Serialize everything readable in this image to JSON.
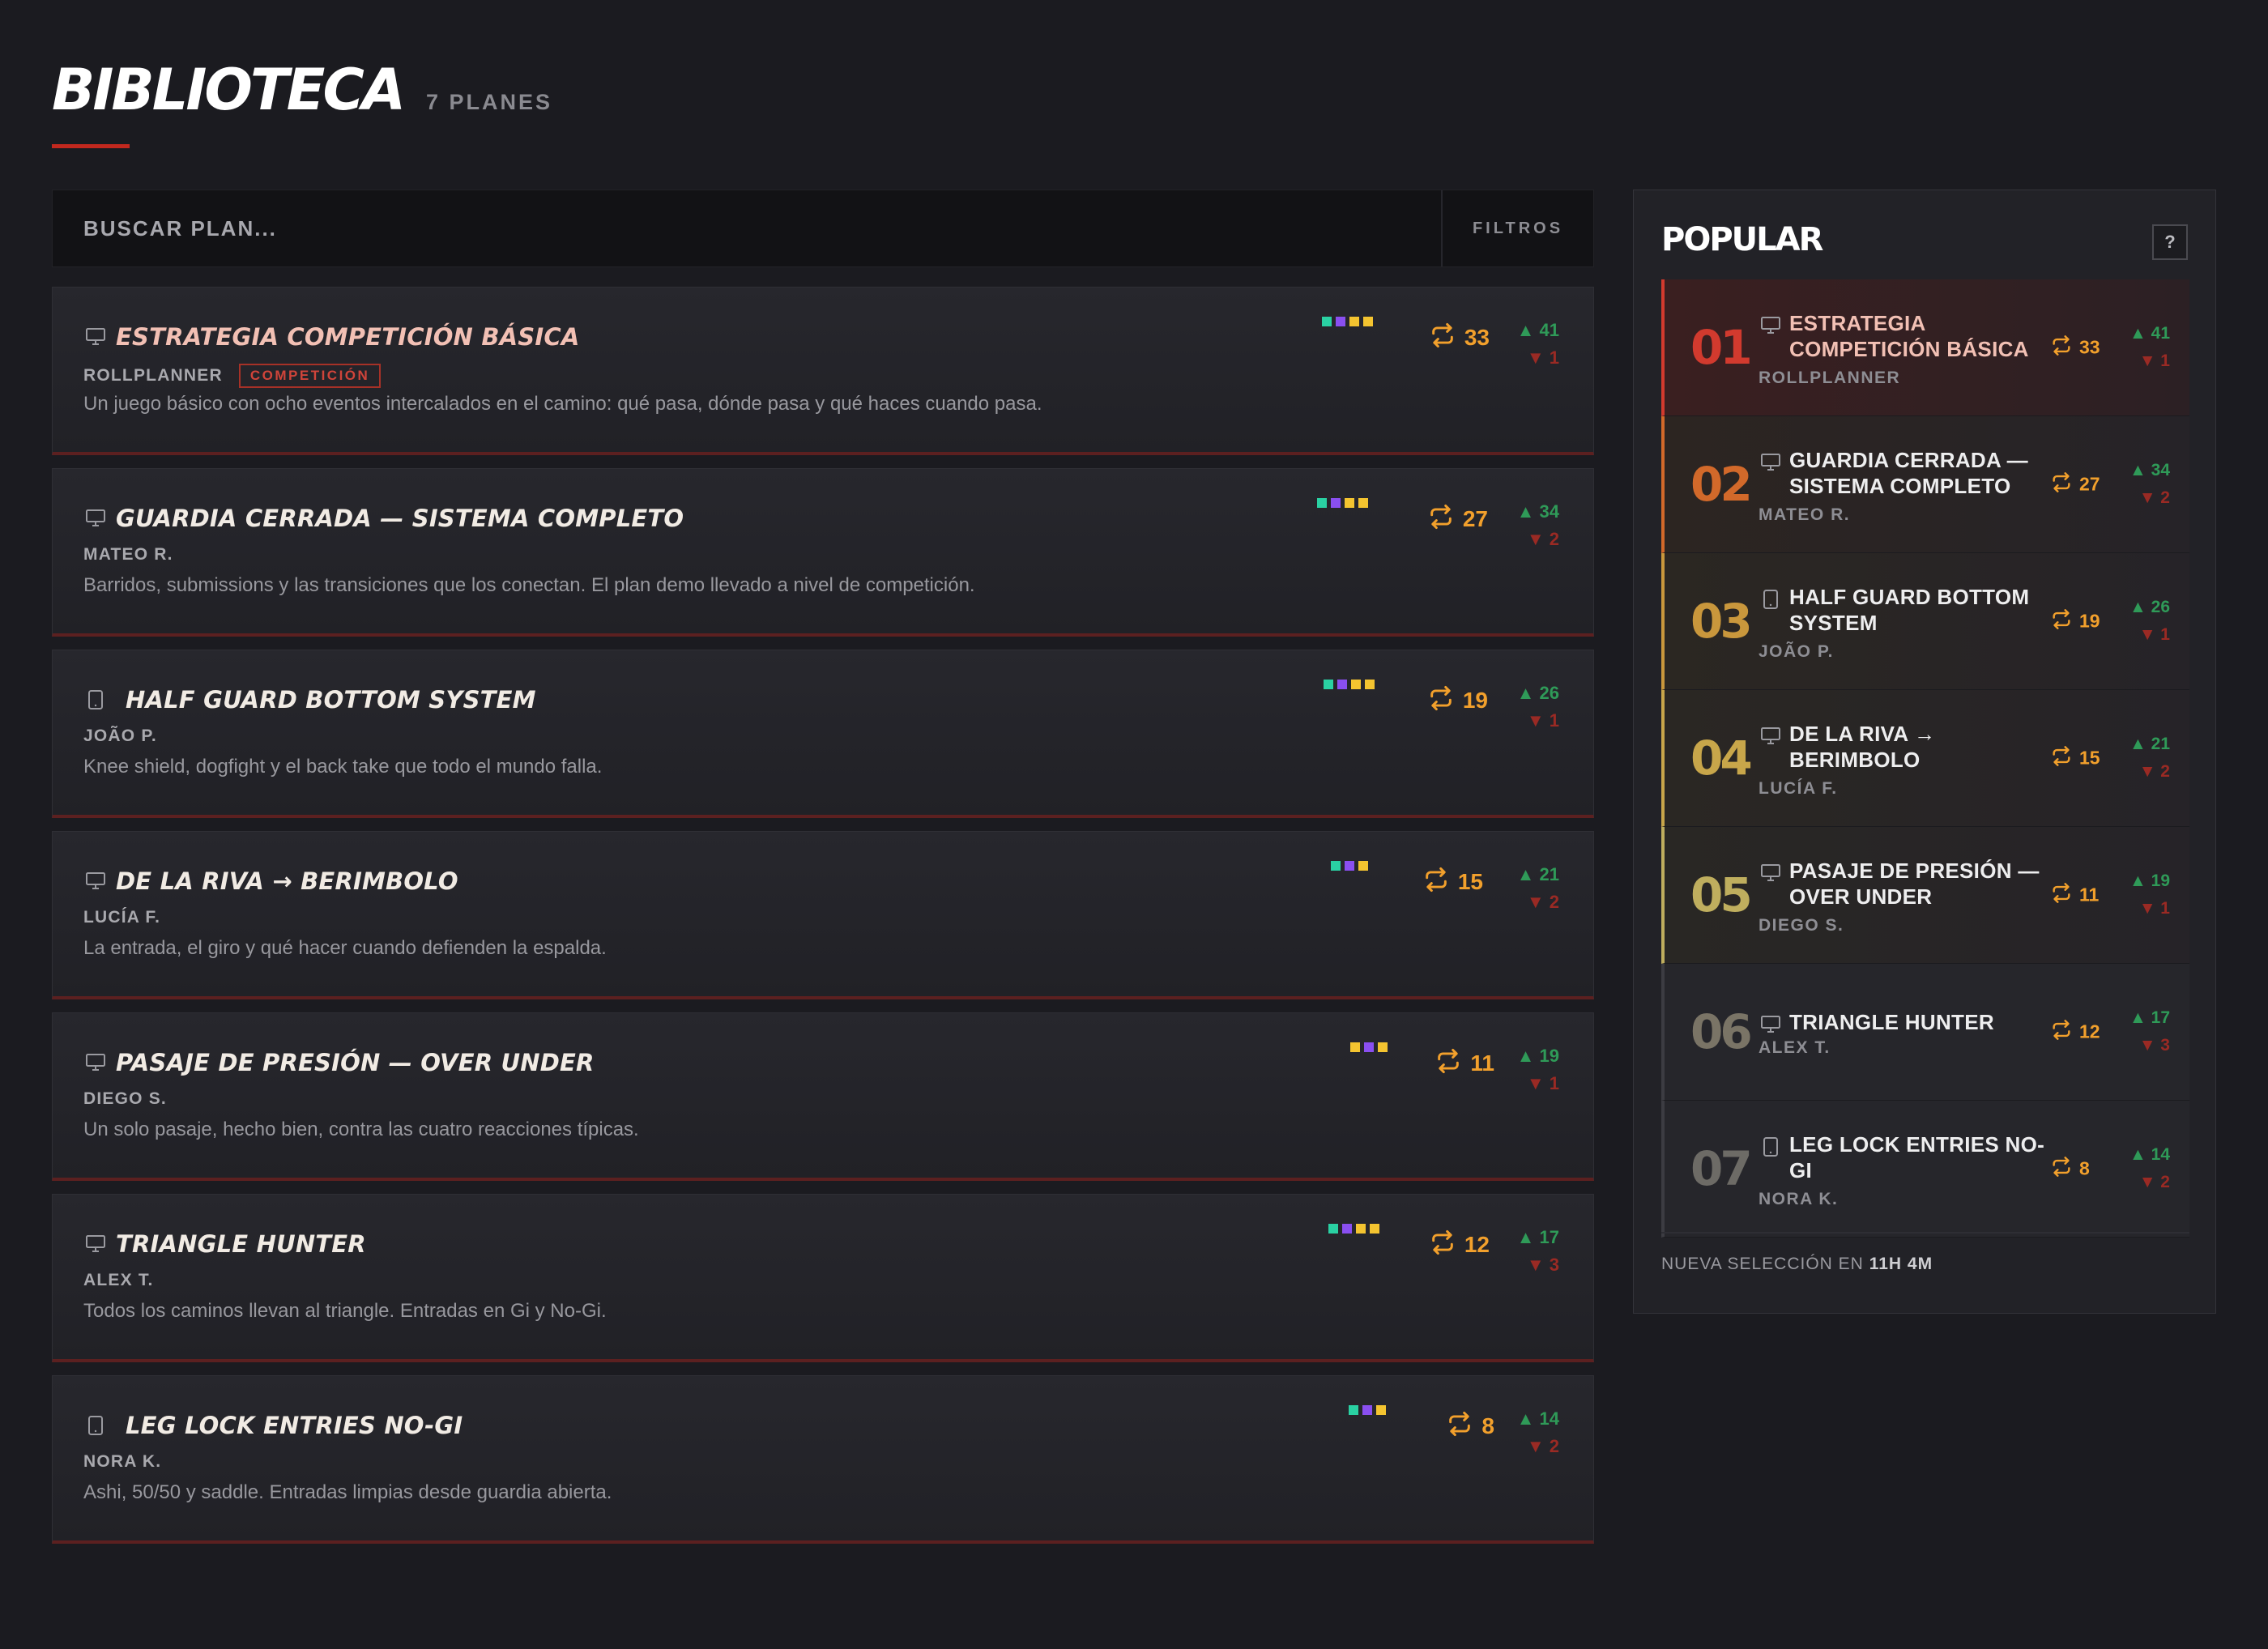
{
  "header": {
    "title": "BIBLIOTECA",
    "count": "7 PLANES"
  },
  "search": {
    "placeholder": "BUSCAR PLAN...",
    "filters_label": "FILTROS"
  },
  "colors": {
    "teal": "#2ad1a3",
    "purple": "#8a4ff0",
    "yellow": "#f4c430",
    "accent_red": "#c2281e",
    "remix_orange": "#f2a02c",
    "vote_up": "#2f9a58",
    "vote_down": "#9a2a24"
  },
  "plans": [
    {
      "title": "ESTRATEGIA COMPETICIÓN BÁSICA",
      "author": "ROLLPLANNER",
      "badge": "COMPETICIÓN",
      "description": "Un juego básico con ocho eventos intercalados en el camino: qué pasa, dónde pasa y qué haces cuando pasa.",
      "remixes": "33",
      "up": "▲ 41",
      "down": "▼ 1",
      "icon": "monitor-icon",
      "dots": [
        "teal",
        "purple",
        "yellow",
        "yellow"
      ]
    },
    {
      "title": "GUARDIA CERRADA — SISTEMA COMPLETO",
      "author": "MATEO R.",
      "badge": "",
      "description": "Barridos, submissions y las transiciones que los conectan. El plan demo llevado a nivel de competición.",
      "remixes": "27",
      "up": "▲ 34",
      "down": "▼ 2",
      "icon": "monitor-icon",
      "dots": [
        "teal",
        "purple",
        "yellow",
        "yellow"
      ]
    },
    {
      "title": "HALF GUARD BOTTOM SYSTEM",
      "author": "JOÃO P.",
      "badge": "",
      "description": "Knee shield, dogfight y el back take que todo el mundo falla.",
      "remixes": "19",
      "up": "▲ 26",
      "down": "▼ 1",
      "icon": "tablet-icon",
      "dots": [
        "teal",
        "purple",
        "yellow",
        "yellow"
      ]
    },
    {
      "title": "DE LA RIVA → BERIMBOLO",
      "author": "LUCÍA F.",
      "badge": "",
      "description": "La entrada, el giro y qué hacer cuando defienden la espalda.",
      "remixes": "15",
      "up": "▲ 21",
      "down": "▼ 2",
      "icon": "monitor-icon",
      "dots": [
        "teal",
        "purple",
        "yellow"
      ]
    },
    {
      "title": "PASAJE DE PRESIÓN — OVER UNDER",
      "author": "DIEGO S.",
      "badge": "",
      "description": "Un solo pasaje, hecho bien, contra las cuatro reacciones típicas.",
      "remixes": "11",
      "up": "▲ 19",
      "down": "▼ 1",
      "icon": "monitor-icon",
      "dots": [
        "yellow",
        "purple",
        "yellow"
      ]
    },
    {
      "title": "TRIANGLE HUNTER",
      "author": "ALEX T.",
      "badge": "",
      "description": "Todos los caminos llevan al triangle. Entradas en Gi y No-Gi.",
      "remixes": "12",
      "up": "▲ 17",
      "down": "▼ 3",
      "icon": "monitor-icon",
      "dots": [
        "teal",
        "purple",
        "yellow",
        "yellow"
      ]
    },
    {
      "title": "LEG LOCK ENTRIES NO-GI",
      "author": "NORA K.",
      "badge": "",
      "description": "Ashi, 50/50 y saddle. Entradas limpias desde guardia abierta.",
      "remixes": "8",
      "up": "▲ 14",
      "down": "▼ 2",
      "icon": "tablet-icon",
      "dots": [
        "teal",
        "purple",
        "yellow"
      ]
    }
  ],
  "popular": {
    "title": "POPULAR",
    "help_label": "?",
    "items": [
      {
        "rank": "01",
        "title": "ESTRATEGIA COMPETICIÓN BÁSICA",
        "author": "ROLLPLANNER",
        "remixes": "33",
        "up": "▲ 41",
        "down": "▼ 1",
        "color": "#d23a2e",
        "icon": "monitor-icon"
      },
      {
        "rank": "02",
        "title": "GUARDIA CERRADA — SISTEMA COMPLETO",
        "author": "MATEO R.",
        "remixes": "27",
        "up": "▲ 34",
        "down": "▼ 2",
        "color": "#d2692a",
        "icon": "monitor-icon"
      },
      {
        "rank": "03",
        "title": "HALF GUARD BOTTOM SYSTEM",
        "author": "JOÃO P.",
        "remixes": "19",
        "up": "▲ 26",
        "down": "▼ 1",
        "color": "#c9973c",
        "icon": "tablet-icon"
      },
      {
        "rank": "04",
        "title": "DE LA RIVA → BERIMBOLO",
        "author": "LUCÍA F.",
        "remixes": "15",
        "up": "▲ 21",
        "down": "▼ 2",
        "color": "#c8a64a",
        "icon": "monitor-icon"
      },
      {
        "rank": "05",
        "title": "PASAJE DE PRESIÓN — OVER UNDER",
        "author": "DIEGO S.",
        "remixes": "11",
        "up": "▲ 19",
        "down": "▼ 1",
        "color": "#bfae5e",
        "icon": "monitor-icon"
      },
      {
        "rank": "06",
        "title": "TRIANGLE HUNTER",
        "author": "ALEX T.",
        "remixes": "12",
        "up": "▲ 17",
        "down": "▼ 3",
        "color": "#7a7466",
        "icon": "monitor-icon"
      },
      {
        "rank": "07",
        "title": "LEG LOCK ENTRIES NO-GI",
        "author": "NORA K.",
        "remixes": "8",
        "up": "▲ 14",
        "down": "▼ 2",
        "color": "#6d6b66",
        "icon": "tablet-icon"
      }
    ],
    "footer_label": "NUEVA SELECCIÓN EN",
    "footer_time": "11H 4M"
  }
}
